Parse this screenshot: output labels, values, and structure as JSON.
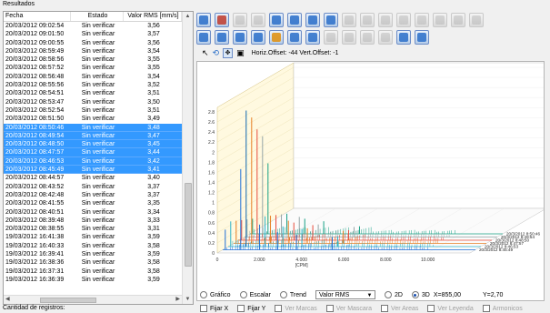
{
  "panel": {
    "results_label": "Resultados",
    "count_label": "Cantidad de registros:"
  },
  "table": {
    "columns": [
      "Fecha",
      "Estado",
      "Valor RMS [mm/s]"
    ],
    "rows": [
      {
        "fecha": "20/03/2012 09:02:54",
        "estado": "Sin verificar",
        "valor": "3,56",
        "selected": false
      },
      {
        "fecha": "20/03/2012 09:01:50",
        "estado": "Sin verificar",
        "valor": "3,57",
        "selected": false
      },
      {
        "fecha": "20/03/2012 09:00:55",
        "estado": "Sin verificar",
        "valor": "3,56",
        "selected": false
      },
      {
        "fecha": "20/03/2012 08:59:49",
        "estado": "Sin verificar",
        "valor": "3,54",
        "selected": false
      },
      {
        "fecha": "20/03/2012 08:58:56",
        "estado": "Sin verificar",
        "valor": "3,55",
        "selected": false
      },
      {
        "fecha": "20/03/2012 08:57:52",
        "estado": "Sin verificar",
        "valor": "3,55",
        "selected": false
      },
      {
        "fecha": "20/03/2012 08:56:48",
        "estado": "Sin verificar",
        "valor": "3,54",
        "selected": false
      },
      {
        "fecha": "20/03/2012 08:55:56",
        "estado": "Sin verificar",
        "valor": "3,52",
        "selected": false
      },
      {
        "fecha": "20/03/2012 08:54:51",
        "estado": "Sin verificar",
        "valor": "3,51",
        "selected": false
      },
      {
        "fecha": "20/03/2012 08:53:47",
        "estado": "Sin verificar",
        "valor": "3,50",
        "selected": false
      },
      {
        "fecha": "20/03/2012 08:52:54",
        "estado": "Sin verificar",
        "valor": "3,51",
        "selected": false
      },
      {
        "fecha": "20/03/2012 08:51:50",
        "estado": "Sin verificar",
        "valor": "3,49",
        "selected": false
      },
      {
        "fecha": "20/03/2012 08:50:46",
        "estado": "Sin verificar",
        "valor": "3,48",
        "selected": true
      },
      {
        "fecha": "20/03/2012 08:49:54",
        "estado": "Sin verificar",
        "valor": "3,47",
        "selected": true
      },
      {
        "fecha": "20/03/2012 08:48:50",
        "estado": "Sin verificar",
        "valor": "3,45",
        "selected": true
      },
      {
        "fecha": "20/03/2012 08:47:57",
        "estado": "Sin verificar",
        "valor": "3,44",
        "selected": true
      },
      {
        "fecha": "20/03/2012 08:46:53",
        "estado": "Sin verificar",
        "valor": "3,42",
        "selected": true
      },
      {
        "fecha": "20/03/2012 08:45:49",
        "estado": "Sin verificar",
        "valor": "3,41",
        "selected": true
      },
      {
        "fecha": "20/03/2012 08:44:57",
        "estado": "Sin verificar",
        "valor": "3,40",
        "selected": false
      },
      {
        "fecha": "20/03/2012 08:43:52",
        "estado": "Sin verificar",
        "valor": "3,37",
        "selected": false
      },
      {
        "fecha": "20/03/2012 08:42:48",
        "estado": "Sin verificar",
        "valor": "3,37",
        "selected": false
      },
      {
        "fecha": "20/03/2012 08:41:55",
        "estado": "Sin verificar",
        "valor": "3,35",
        "selected": false
      },
      {
        "fecha": "20/03/2012 08:40:51",
        "estado": "Sin verificar",
        "valor": "3,34",
        "selected": false
      },
      {
        "fecha": "20/03/2012 08:39:48",
        "estado": "Sin verificar",
        "valor": "3,33",
        "selected": false
      },
      {
        "fecha": "20/03/2012 08:38:55",
        "estado": "Sin verificar",
        "valor": "3,31",
        "selected": false
      },
      {
        "fecha": "19/03/2012 16:41:38",
        "estado": "Sin verificar",
        "valor": "3,59",
        "selected": false
      },
      {
        "fecha": "19/03/2012 16:40:33",
        "estado": "Sin verificar",
        "valor": "3,58",
        "selected": false
      },
      {
        "fecha": "19/03/2012 16:39:41",
        "estado": "Sin verificar",
        "valor": "3,59",
        "selected": false
      },
      {
        "fecha": "19/03/2012 16:38:36",
        "estado": "Sin verificar",
        "valor": "3,58",
        "selected": false
      },
      {
        "fecha": "19/03/2012 16:37:31",
        "estado": "Sin verificar",
        "valor": "3,58",
        "selected": false
      },
      {
        "fecha": "19/03/2012 16:36:39",
        "estado": "Sin verificar",
        "valor": "3,59",
        "selected": false
      }
    ]
  },
  "toolbar": {
    "row1_icons": [
      {
        "name": "rotate-icon",
        "color": "#2a6fc9",
        "disabled": false
      },
      {
        "name": "zoom-reset-icon",
        "color": "#c0392b",
        "disabled": false
      },
      {
        "name": "grid-icon",
        "color": "#a0a0a0",
        "disabled": true
      },
      {
        "name": "table-icon",
        "color": "#a0a0a0",
        "disabled": true
      },
      {
        "name": "chart-bar-icon",
        "color": "#2a6fc9",
        "disabled": false
      },
      {
        "name": "chart-line-icon",
        "color": "#2a6fc9",
        "disabled": false
      },
      {
        "name": "chart-area-icon",
        "color": "#2a6fc9",
        "disabled": false
      },
      {
        "name": "marker-icon",
        "color": "#2a6fc9",
        "disabled": false
      },
      {
        "name": "harmonic-icon",
        "color": "#a0a0a0",
        "disabled": true
      },
      {
        "name": "band-icon",
        "color": "#a0a0a0",
        "disabled": true
      },
      {
        "name": "peak-icon",
        "color": "#a0a0a0",
        "disabled": true
      },
      {
        "name": "sideband-icon",
        "color": "#a0a0a0",
        "disabled": true
      },
      {
        "name": "export-icon",
        "color": "#a0a0a0",
        "disabled": true
      },
      {
        "name": "image-icon",
        "color": "#a0a0a0",
        "disabled": true
      },
      {
        "name": "copy-icon",
        "color": "#a0a0a0",
        "disabled": true
      },
      {
        "name": "print-icon",
        "color": "#a0a0a0",
        "disabled": true
      }
    ],
    "row2_icons": [
      {
        "name": "zoom-in-icon",
        "color": "#2a6fc9",
        "disabled": false
      },
      {
        "name": "zoom-out-icon",
        "color": "#2a6fc9",
        "disabled": false
      },
      {
        "name": "zoom-fit-icon",
        "color": "#2a6fc9",
        "disabled": false
      },
      {
        "name": "zoom-window-icon",
        "color": "#2a6fc9",
        "disabled": false
      },
      {
        "name": "spectrum-icon",
        "color": "#e08e0b",
        "disabled": false
      },
      {
        "name": "waterfall-icon",
        "color": "#2a6fc9",
        "disabled": false
      },
      {
        "name": "cascade-icon",
        "color": "#2a6fc9",
        "disabled": false
      },
      {
        "name": "clear-icon",
        "color": "#a0a0a0",
        "disabled": true
      },
      {
        "name": "save-icon",
        "color": "#a0a0a0",
        "disabled": true
      },
      {
        "name": "load-icon",
        "color": "#a0a0a0",
        "disabled": true
      },
      {
        "name": "filter-icon",
        "color": "#a0a0a0",
        "disabled": true
      },
      {
        "name": "alarm-icon",
        "color": "#2a6fc9",
        "disabled": false
      },
      {
        "name": "report-icon",
        "color": "#2a6fc9",
        "disabled": false
      }
    ]
  },
  "pointer_bar": {
    "offset_text": "Horiz.Offset: -44 Vert.Offset: -1"
  },
  "options": {
    "grafico": "Gráfico",
    "escalar": "Escalar",
    "trend": "Trend",
    "combo_value": "Valor RMS",
    "d2": "2D",
    "d3": "3D",
    "x_readout": "X=855,00",
    "y_readout": "Y=2,70",
    "fijar_x": "Fijar X",
    "fijar_y": "Fijar Y",
    "ver_marcas": "Ver Marcas",
    "ver_mascara": "Ver Mascara",
    "ver_areas": "Ver Areas",
    "ver_leyenda": "Ver Leyenda",
    "armonicos": "Armonicos"
  },
  "chart_data": {
    "type": "waterfall",
    "xlabel": "[CPM]",
    "x_ticks": [
      "0",
      "2.000",
      "4.000",
      "6.000",
      "8.000",
      "10.000"
    ],
    "y_ticks": [
      "0",
      "0.2",
      "0.4",
      "0.6",
      "0.8",
      "1",
      "1.2",
      "1.4",
      "1.6",
      "1.8",
      "2",
      "2.2",
      "2.4",
      "2.6",
      "2.8"
    ],
    "ylim": [
      0,
      2.8
    ],
    "xlim": [
      0,
      12000
    ],
    "series": [
      {
        "name": "20/3/2012 8:45:49",
        "color": "#1f6fd6",
        "peaks": [
          [
            120,
            0.4
          ],
          [
            855,
            1.6
          ],
          [
            1750,
            0.5
          ],
          [
            2600,
            0.35
          ],
          [
            3500,
            0.3
          ],
          [
            5200,
            0.25
          ]
        ]
      },
      {
        "name": "20/3/2012 8:46:53",
        "color": "#2db3c9",
        "peaks": [
          [
            120,
            0.5
          ],
          [
            855,
            2.7
          ],
          [
            1750,
            0.6
          ],
          [
            2600,
            0.4
          ],
          [
            3500,
            0.35
          ],
          [
            5200,
            0.2
          ]
        ]
      },
      {
        "name": "20/3/2012 8:47:57",
        "color": "#e67e22",
        "peaks": [
          [
            120,
            0.45
          ],
          [
            855,
            2.5
          ],
          [
            1750,
            0.55
          ],
          [
            2600,
            0.45
          ],
          [
            3500,
            0.3
          ],
          [
            5200,
            0.25
          ]
        ]
      },
      {
        "name": "20/3/2012 8:48:50",
        "color": "#e74c3c",
        "peaks": [
          [
            120,
            0.4
          ],
          [
            855,
            2.2
          ],
          [
            1750,
            0.5
          ],
          [
            2600,
            0.35
          ],
          [
            3500,
            0.3
          ],
          [
            5200,
            0.2
          ]
        ]
      },
      {
        "name": "20/3/2012 8:49:54",
        "color": "#95a5a6",
        "peaks": [
          [
            120,
            0.35
          ],
          [
            855,
            2.0
          ],
          [
            1750,
            0.45
          ],
          [
            2600,
            0.4
          ],
          [
            3500,
            0.25
          ],
          [
            5200,
            0.2
          ]
        ]
      },
      {
        "name": "20/3/2012 8:50:46",
        "color": "#16a085",
        "peaks": [
          [
            120,
            0.3
          ],
          [
            855,
            1.4
          ],
          [
            1750,
            0.4
          ],
          [
            2600,
            0.3
          ],
          [
            3500,
            0.25
          ],
          [
            5200,
            0.15
          ]
        ]
      }
    ]
  }
}
